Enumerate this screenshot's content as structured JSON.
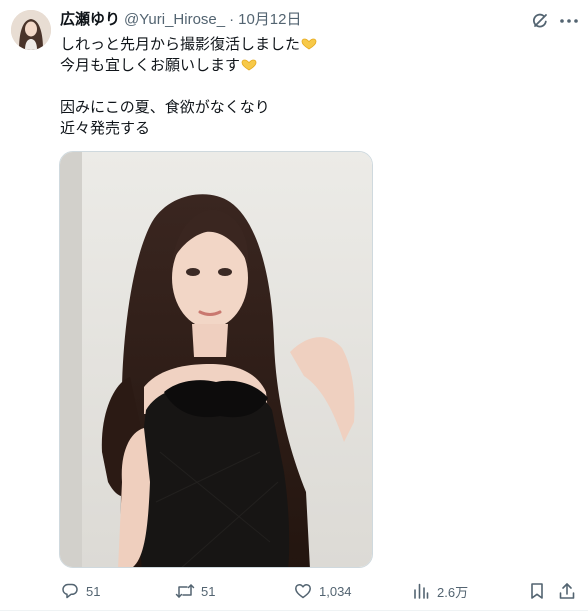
{
  "author": {
    "display_name": "広瀬ゆり",
    "handle": "@Yuri_Hirose_",
    "separator": "·",
    "timestamp": "10月12日"
  },
  "tweet": {
    "lines": [
      "しれっと先月から撮影復活しました",
      "今月も宜しくお願いします",
      "",
      "因みにこの夏、食欲がなくなり",
      "近々発売する"
    ],
    "emoji": "heart-hands-emoji"
  },
  "actions": {
    "replies": "51",
    "reposts": "51",
    "likes": "1,034",
    "views": "2.6万"
  },
  "icons": {
    "grok": "grok-icon",
    "more": "more-icon",
    "reply": "reply-icon",
    "repost": "repost-icon",
    "like": "heart-icon",
    "views": "views-icon",
    "bookmark": "bookmark-icon",
    "share": "share-icon"
  },
  "colors": {
    "text": "#0f1419",
    "secondary": "#536471",
    "border": "#cfd9de",
    "emoji": "#f7c948"
  }
}
